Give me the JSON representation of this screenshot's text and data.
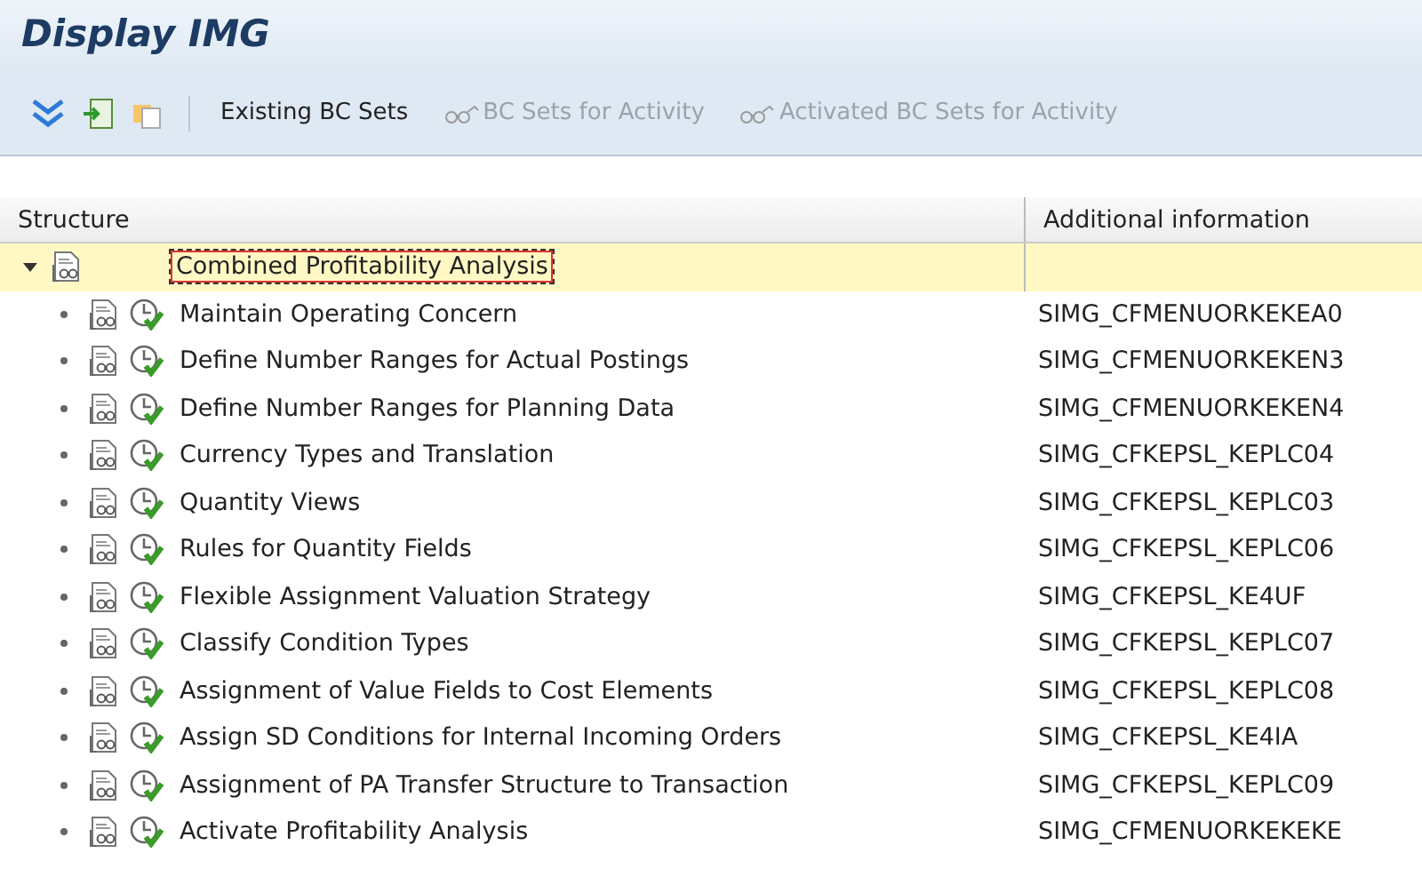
{
  "window": {
    "title": "Display IMG"
  },
  "toolbar": {
    "buttons": [
      {
        "label": "Existing BC Sets",
        "disabled": false
      },
      {
        "label": "BC Sets for Activity",
        "disabled": true
      },
      {
        "label": "Activated BC Sets for Activity",
        "disabled": true
      }
    ]
  },
  "tree": {
    "columns": [
      "Structure",
      "Additional information"
    ],
    "root": {
      "label": "Combined Profitability Analysis",
      "expanded": true,
      "selected": true,
      "children": [
        {
          "label": "Maintain Operating Concern",
          "info": "SIMG_CFMENUORKEKEA0",
          "selected": false
        },
        {
          "label": "Define Number Ranges for Actual Postings",
          "info": "SIMG_CFMENUORKEKEN3",
          "selected": false
        },
        {
          "label": "Define Number Ranges for Planning Data",
          "info": "SIMG_CFMENUORKEKEN4",
          "selected": false
        },
        {
          "label": "Currency Types and Translation",
          "info": "SIMG_CFKEPSL_KEPLC04",
          "selected": false
        },
        {
          "label": "Quantity Views",
          "info": "SIMG_CFKEPSL_KEPLC03",
          "selected": false
        },
        {
          "label": "Rules for Quantity Fields",
          "info": "SIMG_CFKEPSL_KEPLC06",
          "selected": false
        },
        {
          "label": "Flexible Assignment Valuation Strategy",
          "info": "SIMG_CFKEPSL_KE4UF",
          "selected": false
        },
        {
          "label": "Classify Condition Types",
          "info": "SIMG_CFKEPSL_KEPLC07",
          "selected": false
        },
        {
          "label": "Assignment of Value Fields to Cost Elements",
          "info": "SIMG_CFKEPSL_KEPLC08",
          "selected": false
        },
        {
          "label": "Assign SD Conditions for Internal Incoming Orders",
          "info": "SIMG_CFKEPSL_KE4IA",
          "selected": false
        },
        {
          "label": "Assignment of PA Transfer Structure to Transaction",
          "info": "SIMG_CFKEPSL_KEPLC09",
          "selected": false
        },
        {
          "label": "Activate Profitability Analysis",
          "info": "SIMG_CFMENUORKEKEKE",
          "selected": false
        }
      ]
    }
  }
}
